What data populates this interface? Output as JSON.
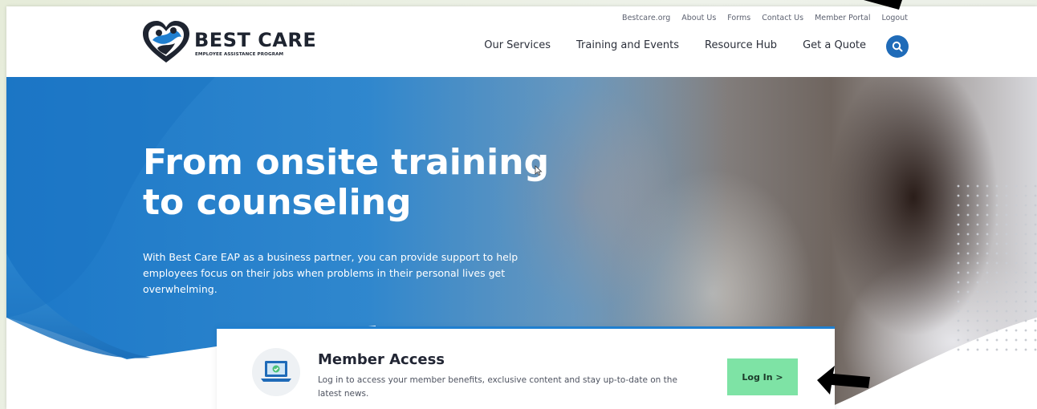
{
  "header": {
    "logo_title": "BEST CARE",
    "logo_subtitle": "EMPLOYEE ASSISTANCE PROGRAM",
    "utility_links": [
      "Bestcare.org",
      "About Us",
      "Forms",
      "Contact Us",
      "Member Portal",
      "Logout"
    ],
    "main_links": [
      "Our Services",
      "Training and Events",
      "Resource Hub",
      "Get a Quote"
    ],
    "search_icon": "search-icon"
  },
  "hero": {
    "title_line1": "From onsite training",
    "title_line2": "to counseling",
    "description": "With Best Care EAP as a business partner, you can provide support to help employees focus on their jobs when problems in their personal lives get overwhelming."
  },
  "member_access": {
    "title": "Member Access",
    "description": "Log in to access your member benefits, exclusive content and stay up-to-date on the latest news.",
    "login_label": "Log In >",
    "icon": "laptop-check-icon"
  },
  "colors": {
    "brand_blue": "#1f6bb8",
    "accent_blue": "#1f7fd0",
    "login_green": "#7ee3a5",
    "text_dark": "#222634"
  }
}
